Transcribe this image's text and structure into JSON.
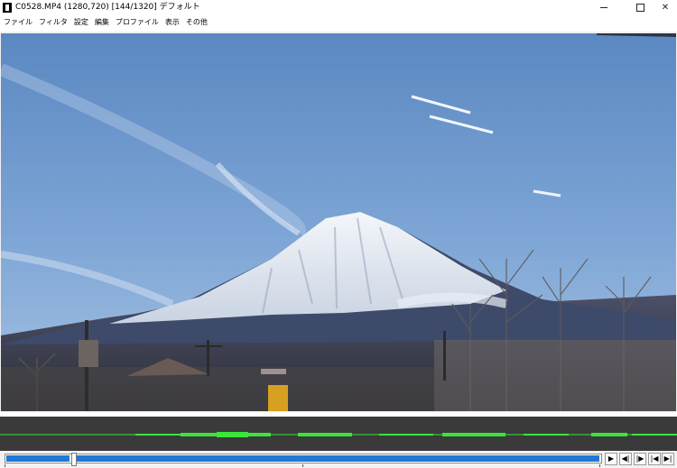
{
  "window": {
    "title": "C0528.MP4 (1280,720)  [144/1320]  デフォルト",
    "minimize_icon": "minimize-icon",
    "maximize_icon": "maximize-icon",
    "close_glyph": "✕"
  },
  "menu": {
    "items": [
      "ファイル",
      "フィルタ",
      "設定",
      "編集",
      "プロファイル",
      "表示",
      "その他"
    ]
  },
  "video": {
    "content": "mountain-landscape-frame"
  },
  "playback": {
    "current_frame": 144,
    "total_frames": 1320,
    "buttons": [
      {
        "name": "play-button",
        "glyph": "▶"
      },
      {
        "name": "step-back-button",
        "glyph": "◀|"
      },
      {
        "name": "step-forward-button",
        "glyph": "|▶"
      },
      {
        "name": "jump-start-button",
        "glyph": "|◀"
      },
      {
        "name": "jump-end-button",
        "glyph": "▶|"
      }
    ]
  },
  "colors": {
    "seek_fill": "#1e7ad6",
    "waveform_bg": "#3a3a3a",
    "waveform_line": "#39e639"
  }
}
